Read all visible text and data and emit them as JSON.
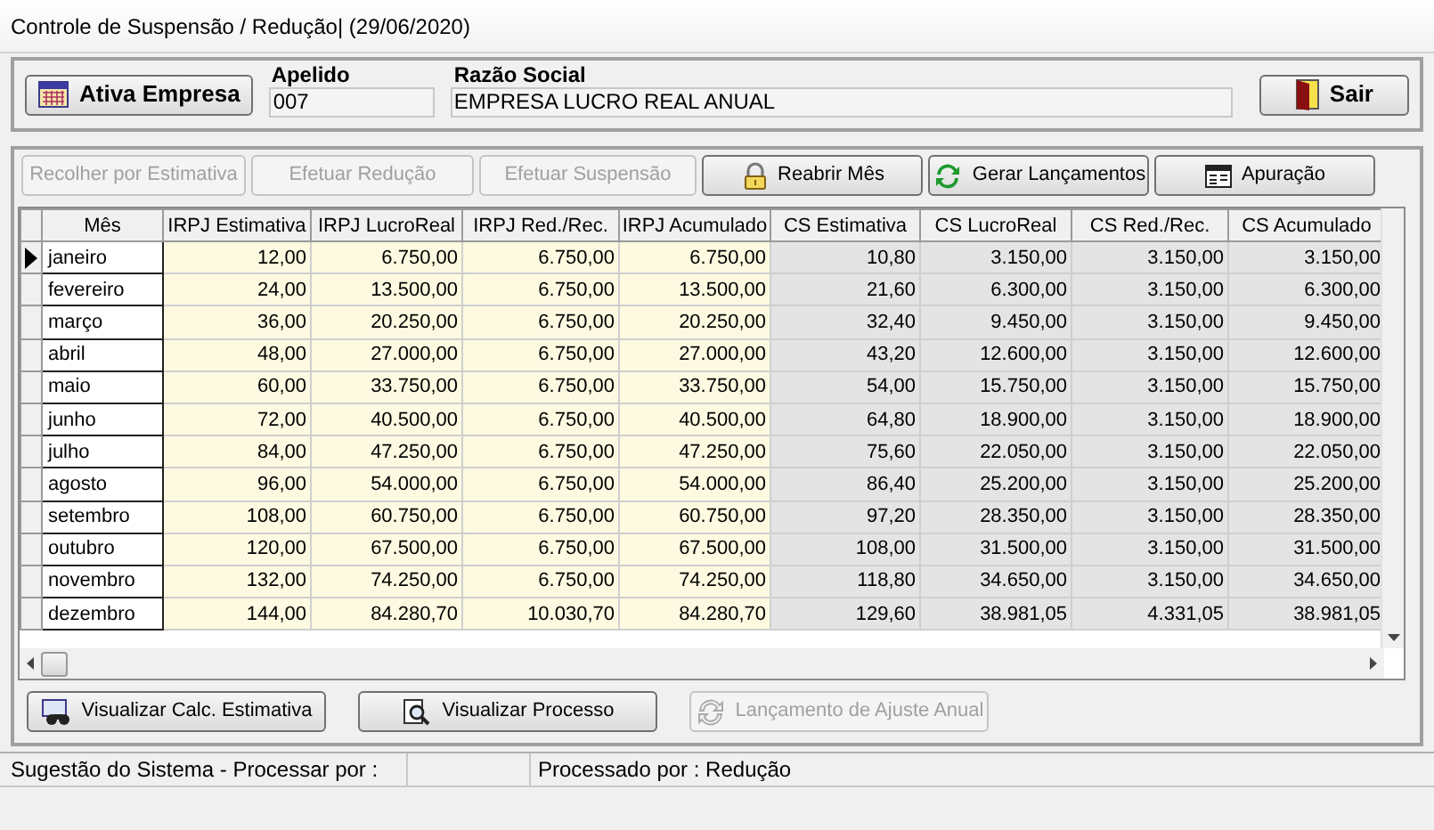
{
  "window": {
    "title": "Controle de Suspensão / Redução| (29/06/2020)"
  },
  "company": {
    "activate_button": "Ativa Empresa",
    "nickname_label": "Apelido",
    "nickname": "007",
    "name_label": "Razão Social",
    "name": "EMPRESA LUCRO REAL ANUAL",
    "exit_button": "Sair"
  },
  "actions": [
    {
      "label": "Recolher por Estimativa",
      "disabled": true
    },
    {
      "label": "Efetuar Redução",
      "disabled": true
    },
    {
      "label": "Efetuar Suspensão",
      "disabled": true
    },
    {
      "label": "Reabrir Mês",
      "disabled": false
    },
    {
      "label": "Gerar Lançamentos",
      "disabled": false
    },
    {
      "label": "Apuração",
      "disabled": false
    }
  ],
  "table": {
    "columns": [
      {
        "label": "Mês",
        "kind": "month"
      },
      {
        "label": "IRPJ Estimativa",
        "kind": "irpj"
      },
      {
        "label": "IRPJ LucroReal",
        "kind": "irpj"
      },
      {
        "label": "IRPJ Red./Rec.",
        "kind": "irpj"
      },
      {
        "label": "IRPJ Acumulado",
        "kind": "irpj"
      },
      {
        "label": "CS Estimativa",
        "kind": "cs"
      },
      {
        "label": "CS LucroReal",
        "kind": "cs"
      },
      {
        "label": "CS Red./Rec.",
        "kind": "cs"
      },
      {
        "label": "CS Acumulado",
        "kind": "cs"
      }
    ],
    "rows": [
      {
        "selected": true,
        "cells": [
          "janeiro",
          "12,00",
          "6.750,00",
          "6.750,00",
          "6.750,00",
          "10,80",
          "3.150,00",
          "3.150,00",
          "3.150,00"
        ]
      },
      {
        "selected": false,
        "cells": [
          "fevereiro",
          "24,00",
          "13.500,00",
          "6.750,00",
          "13.500,00",
          "21,60",
          "6.300,00",
          "3.150,00",
          "6.300,00"
        ]
      },
      {
        "selected": false,
        "cells": [
          "março",
          "36,00",
          "20.250,00",
          "6.750,00",
          "20.250,00",
          "32,40",
          "9.450,00",
          "3.150,00",
          "9.450,00"
        ]
      },
      {
        "selected": false,
        "cells": [
          "abril",
          "48,00",
          "27.000,00",
          "6.750,00",
          "27.000,00",
          "43,20",
          "12.600,00",
          "3.150,00",
          "12.600,00"
        ]
      },
      {
        "selected": false,
        "cells": [
          "maio",
          "60,00",
          "33.750,00",
          "6.750,00",
          "33.750,00",
          "54,00",
          "15.750,00",
          "3.150,00",
          "15.750,00"
        ]
      },
      {
        "selected": false,
        "cells": [
          "junho",
          "72,00",
          "40.500,00",
          "6.750,00",
          "40.500,00",
          "64,80",
          "18.900,00",
          "3.150,00",
          "18.900,00"
        ]
      },
      {
        "selected": false,
        "cells": [
          "julho",
          "84,00",
          "47.250,00",
          "6.750,00",
          "47.250,00",
          "75,60",
          "22.050,00",
          "3.150,00",
          "22.050,00"
        ]
      },
      {
        "selected": false,
        "cells": [
          "agosto",
          "96,00",
          "54.000,00",
          "6.750,00",
          "54.000,00",
          "86,40",
          "25.200,00",
          "3.150,00",
          "25.200,00"
        ]
      },
      {
        "selected": false,
        "cells": [
          "setembro",
          "108,00",
          "60.750,00",
          "6.750,00",
          "60.750,00",
          "97,20",
          "28.350,00",
          "3.150,00",
          "28.350,00"
        ]
      },
      {
        "selected": false,
        "cells": [
          "outubro",
          "120,00",
          "67.500,00",
          "6.750,00",
          "67.500,00",
          "108,00",
          "31.500,00",
          "3.150,00",
          "31.500,00"
        ]
      },
      {
        "selected": false,
        "cells": [
          "novembro",
          "132,00",
          "74.250,00",
          "6.750,00",
          "74.250,00",
          "118,80",
          "34.650,00",
          "3.150,00",
          "34.650,00"
        ]
      },
      {
        "selected": false,
        "cells": [
          "dezembro",
          "144,00",
          "84.280,70",
          "10.030,70",
          "84.280,70",
          "129,60",
          "38.981,05",
          "4.331,05",
          "38.981,05"
        ]
      }
    ]
  },
  "bottom_actions": [
    {
      "label": "Visualizar Calc. Estimativa",
      "disabled": false
    },
    {
      "label": "Visualizar Processo",
      "disabled": false
    },
    {
      "label": "Lançamento de Ajuste Anual",
      "disabled": true
    }
  ],
  "status_bar": {
    "suggestion": "Sugestão do Sistema - Processar por :",
    "processed": "Processado por : Redução"
  }
}
